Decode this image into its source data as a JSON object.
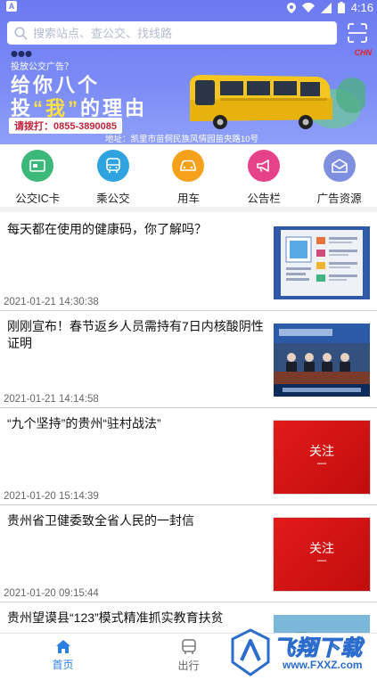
{
  "statusbar": {
    "time": "4:16",
    "left_badge": "A"
  },
  "search": {
    "placeholder": "搜索站点、查公交、找线路"
  },
  "banner": {
    "small_text": "投放公交广告？",
    "title_line1": "给你八个",
    "title_line2_a": "投",
    "title_line2_b": "“我”",
    "title_line2_c": "的理由",
    "phone": "请拨打：0855-3890085",
    "address": "地址：凯里市苗侗民族风情园苗央路10号",
    "brand": "CHN"
  },
  "menu": [
    {
      "label": "公交IC卡",
      "icon": "ic-card-icon",
      "color": "#3cb97a"
    },
    {
      "label": "乘公交",
      "icon": "bus-icon",
      "color": "#2fa3e0"
    },
    {
      "label": "用车",
      "icon": "car-icon",
      "color": "#f5a11b"
    },
    {
      "label": "公告栏",
      "icon": "megaphone-icon",
      "color": "#e6428a"
    },
    {
      "label": "广告资源",
      "icon": "mail-icon",
      "color": "#7f8fe0"
    }
  ],
  "news": [
    {
      "title": "每天都在使用的健康码，你了解吗？",
      "time": "2021-01-21 14:30:38",
      "thumb": "health-code-thumbnail"
    },
    {
      "title": "刚刚宣布！春节返乡人员需持有7日内核酸阴性证明",
      "time": "2021-01-21 14:14:58",
      "thumb": "press-conference-thumbnail"
    },
    {
      "title": "“九个坚持”的贵州“驻村战法”",
      "time": "2021-01-20 15:14:39",
      "thumb": "follow-thumbnail",
      "thumb_text": "关注"
    },
    {
      "title": "贵州省卫健委致全省人民的一封信",
      "time": "2021-01-20 09:15:44",
      "thumb": "follow-thumbnail",
      "thumb_text": "关注"
    },
    {
      "title": "贵州望谟县“123”模式精准抓实教育扶贫",
      "time": "",
      "thumb": "landscape-thumbnail"
    }
  ],
  "bottom_nav": [
    {
      "label": "首页",
      "icon": "home-icon",
      "active": true
    },
    {
      "label": "出行",
      "icon": "bus-nav-icon",
      "active": false
    }
  ],
  "watermark": {
    "text": "飞翔下载",
    "url": "www.FXXZ.com"
  },
  "colors": {
    "accent": "#2b7fe0",
    "header": "#6b7af0"
  }
}
